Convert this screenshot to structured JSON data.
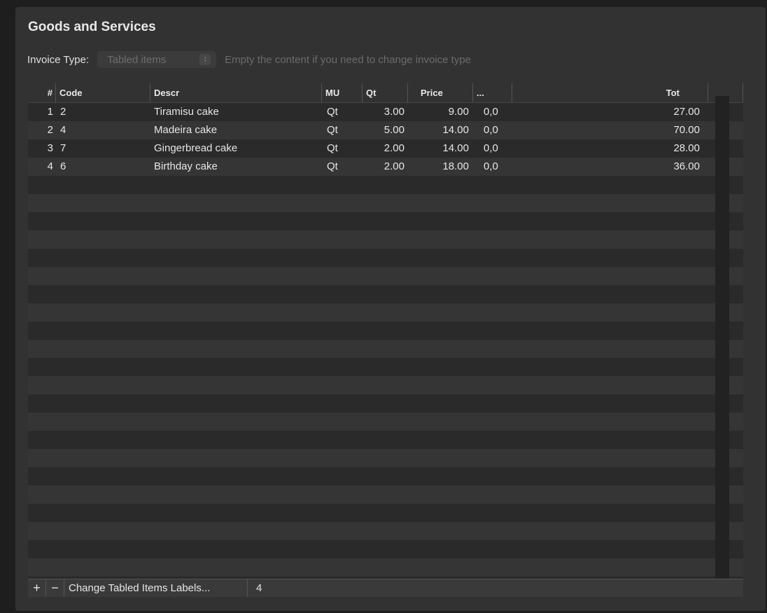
{
  "section_title": "Goods and Services",
  "invoice_type": {
    "label": "Invoice Type:",
    "selected": "Tabled items",
    "hint": "Empty the content if you need to change invoice type"
  },
  "columns": {
    "idx": "#",
    "code": "Code",
    "descr": "Descr",
    "mu": "MU",
    "qt": "Qt",
    "price": "Price",
    "extra": "...",
    "tot": "Tot"
  },
  "rows": [
    {
      "idx": "1",
      "code": "2",
      "descr": "Tiramisu cake",
      "mu": "Qt",
      "qt": "3.00",
      "price": "9.00",
      "extra": "0,0",
      "tot": "27.00"
    },
    {
      "idx": "2",
      "code": "4",
      "descr": "Madeira cake",
      "mu": "Qt",
      "qt": "5.00",
      "price": "14.00",
      "extra": "0,0",
      "tot": "70.00"
    },
    {
      "idx": "3",
      "code": "7",
      "descr": "Gingerbread cake",
      "mu": "Qt",
      "qt": "2.00",
      "price": "14.00",
      "extra": "0,0",
      "tot": "28.00"
    },
    {
      "idx": "4",
      "code": "6",
      "descr": "Birthday cake",
      "mu": "Qt",
      "qt": "2.00",
      "price": "18.00",
      "extra": "0,0",
      "tot": "36.00"
    }
  ],
  "footer": {
    "add": "+",
    "remove": "−",
    "change_labels": "Change Tabled Items Labels...",
    "count": "4"
  },
  "colors": {
    "background": "#323232",
    "row_odd": "#2a2a2a",
    "row_even": "#353535",
    "text": "#e6e6e6",
    "muted": "#6b6b6b"
  }
}
